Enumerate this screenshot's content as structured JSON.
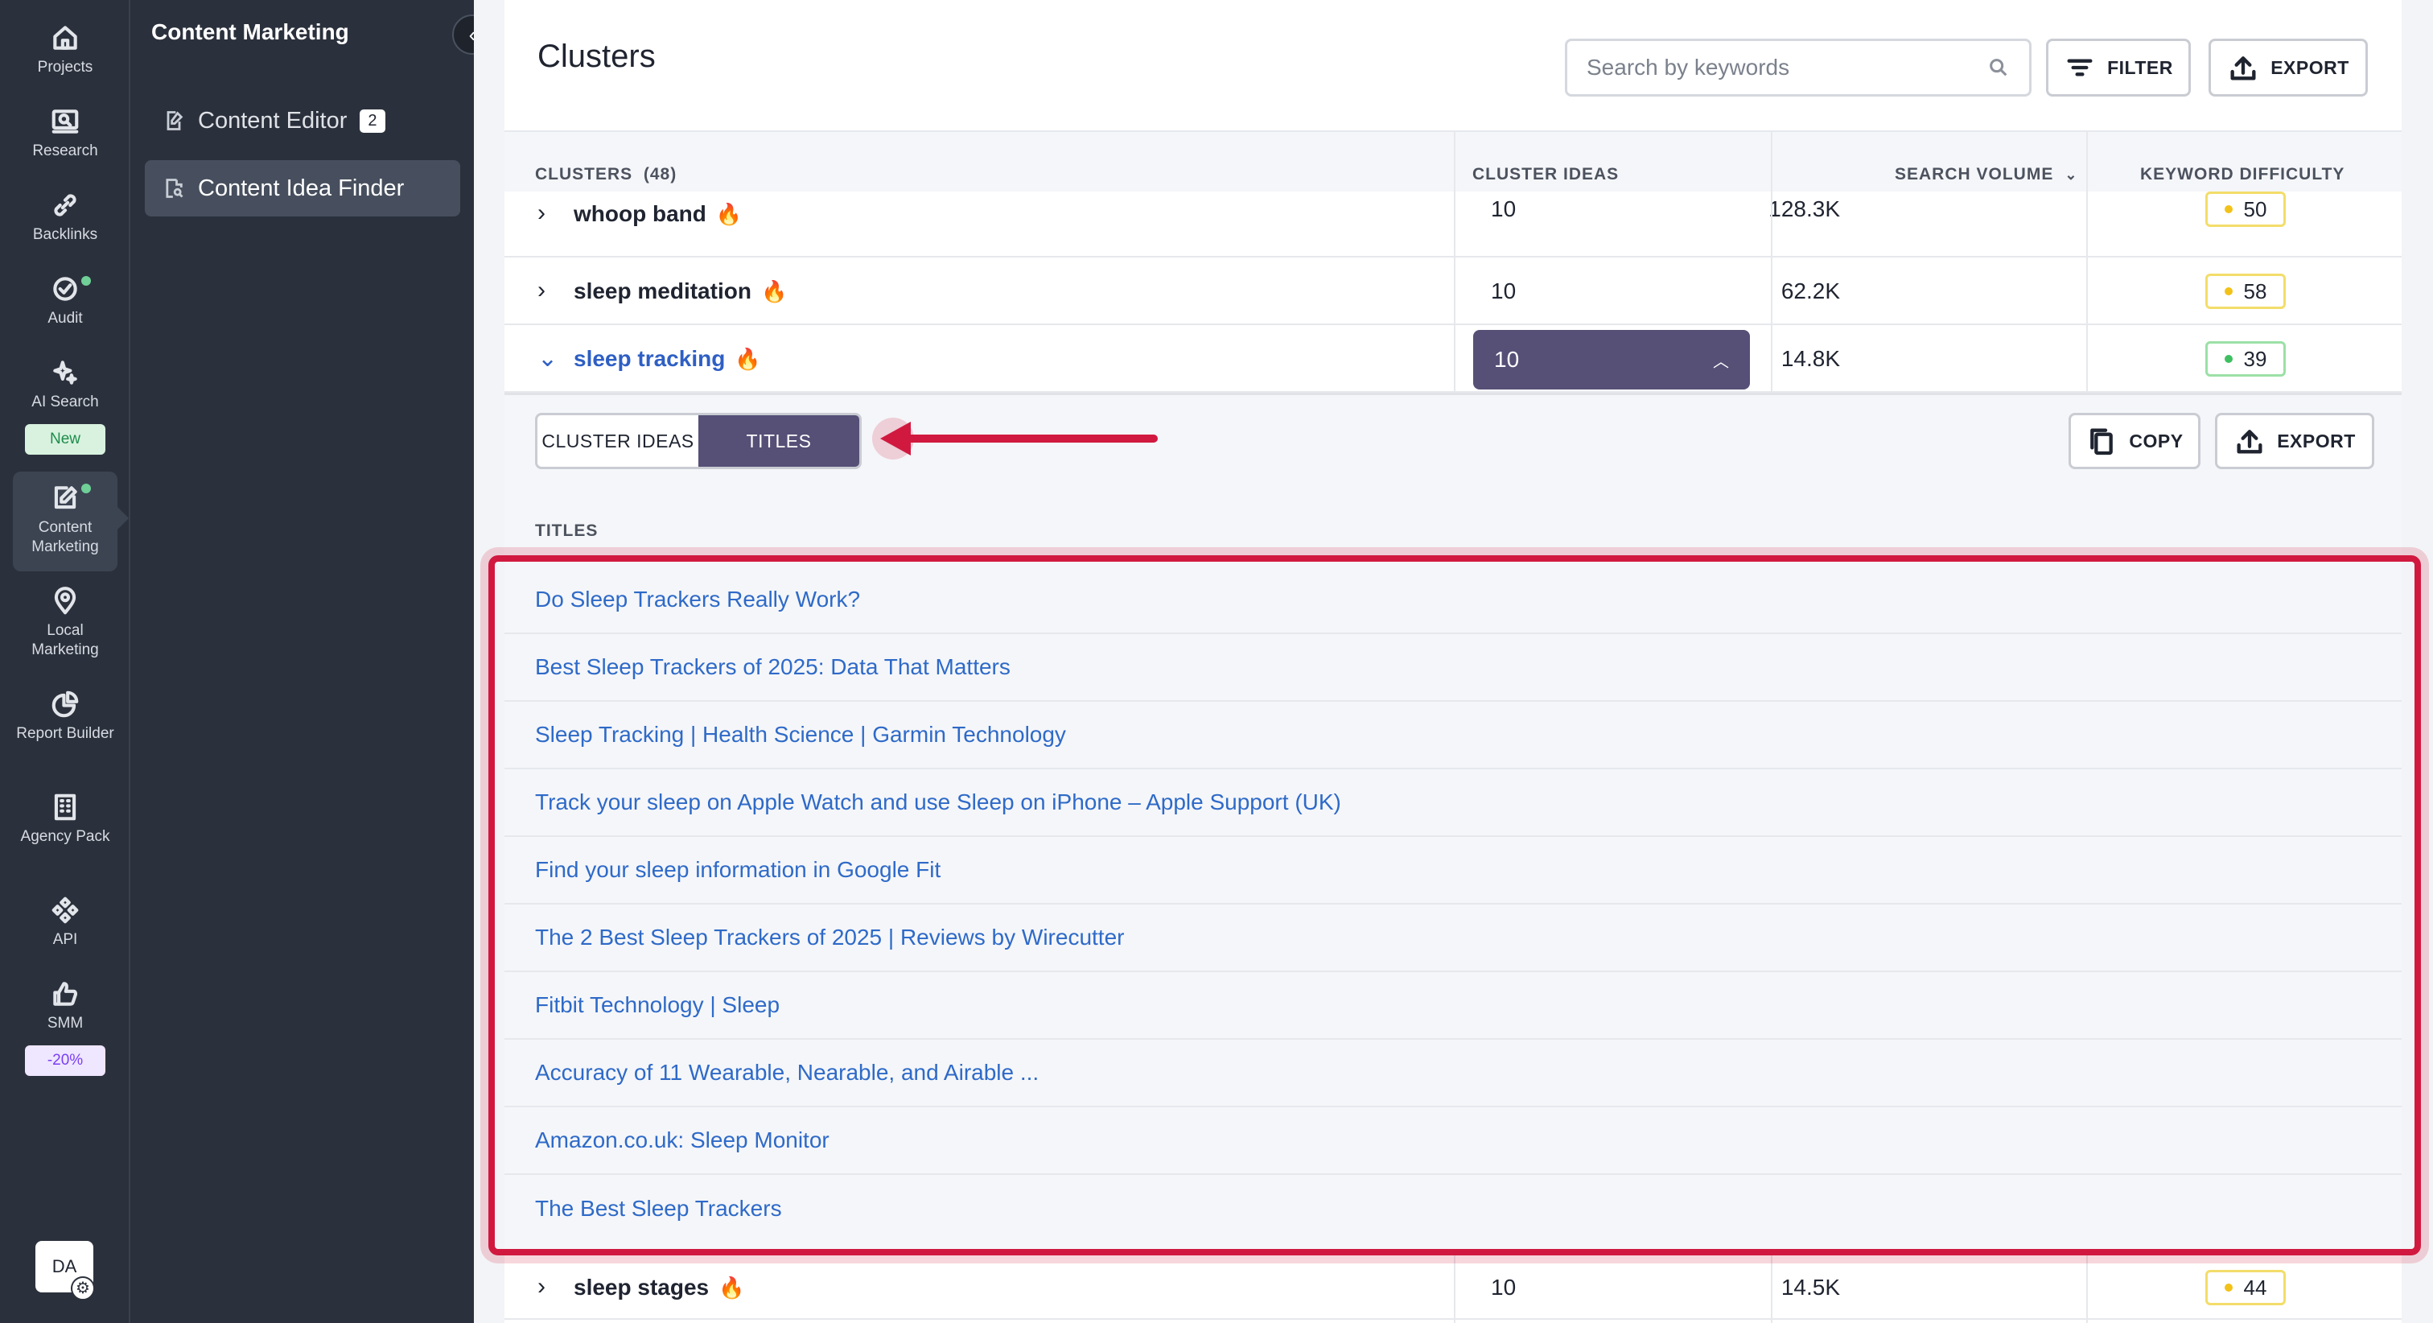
{
  "rail": {
    "items": [
      {
        "label": "Projects",
        "icon": "home-icon"
      },
      {
        "label": "Research",
        "icon": "research-icon"
      },
      {
        "label": "Backlinks",
        "icon": "link-icon"
      },
      {
        "label": "Audit",
        "icon": "check-circle-icon"
      },
      {
        "label": "AI Search",
        "icon": "sparkle-icon",
        "badge": "New"
      },
      {
        "label": "Content Marketing",
        "icon": "edit-icon"
      },
      {
        "label": "Local Marketing",
        "icon": "map-pin-icon"
      },
      {
        "label": "Report Builder",
        "icon": "pie-chart-icon"
      },
      {
        "label": "Agency Pack",
        "icon": "building-icon"
      },
      {
        "label": "API",
        "icon": "api-icon"
      },
      {
        "label": "SMM",
        "icon": "thumbs-up-icon",
        "badge": "-20%"
      }
    ],
    "avatar": "DA"
  },
  "section": {
    "title": "Content Marketing",
    "items": [
      {
        "label": "Content Editor",
        "count": "2"
      },
      {
        "label": "Content Idea Finder"
      }
    ]
  },
  "main": {
    "title": "Clusters",
    "search_placeholder": "Search by keywords",
    "filter_label": "FILTER",
    "export_label": "EXPORT"
  },
  "table": {
    "headers": {
      "clusters": "CLUSTERS",
      "clusters_count": "(48)",
      "cluster_ideas": "CLUSTER IDEAS",
      "search_volume": "SEARCH VOLUME",
      "keyword_difficulty": "KEYWORD DIFFICULTY"
    },
    "rows": [
      {
        "keyword": "whoop band",
        "ideas": "10",
        "volume": "128.3K",
        "kd": "50"
      },
      {
        "keyword": "sleep meditation",
        "ideas": "10",
        "volume": "62.2K",
        "kd": "58"
      },
      {
        "keyword": "sleep tracking",
        "ideas": "10",
        "volume": "14.8K",
        "kd": "39"
      },
      {
        "keyword": "sleep stages",
        "ideas": "10",
        "volume": "14.5K",
        "kd": "44"
      }
    ]
  },
  "panel": {
    "tab_cluster_ideas": "CLUSTER IDEAS",
    "tab_titles": "TITLES",
    "copy_label": "COPY",
    "export_label": "EXPORT",
    "titles_heading": "TITLES",
    "titles": [
      "Do Sleep Trackers Really Work?",
      "Best Sleep Trackers of 2025: Data That Matters",
      "Sleep Tracking | Health Science | Garmin Technology",
      "Track your sleep on Apple Watch and use Sleep on iPhone – Apple Support (UK)",
      "Find your sleep information in Google Fit",
      "The 2 Best Sleep Trackers of 2025 | Reviews by Wirecutter",
      "Fitbit Technology | Sleep",
      "Accuracy of 11 Wearable, Nearable, and Airable ...",
      "Amazon.co.uk: Sleep Monitor",
      "The Best Sleep Trackers"
    ]
  },
  "colors": {
    "sidebar_bg": "#2b313c",
    "accent_purple": "#564f76",
    "link_blue": "#2e6ac8",
    "annotation_red": "#d1193f",
    "kd_yellow": "#f2c21a",
    "kd_green": "#3fbf62"
  }
}
